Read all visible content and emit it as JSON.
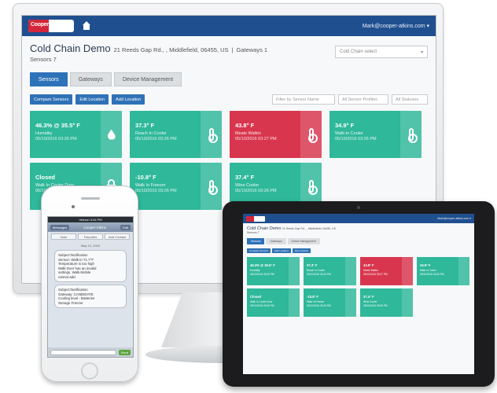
{
  "app": {
    "logo_text": "Cooper",
    "user": "Mark@cooper-atkins.com ▾",
    "title": "Cold Chain Demo",
    "address": "21 Reeds Gap Rd., , Middlefield, 06455, US",
    "gateways": "Gateways 1",
    "sensors": "Sensors 7",
    "select_placeholder": "Cold Chain select"
  },
  "tabs": [
    {
      "label": "Sensors",
      "active": true
    },
    {
      "label": "Gateways",
      "active": false
    },
    {
      "label": "Device Management",
      "active": false
    }
  ],
  "toolbar": {
    "buttons": [
      "Compare Sensors",
      "Edit Location",
      "Add Location"
    ],
    "filter_name": "Filter by Sensor Name",
    "filter_profile": "All Sensor Profiles",
    "filter_status": "All Statuses"
  },
  "cards": [
    {
      "reading": "46.3% @ 35.5° F",
      "name": "Humidity",
      "time": "05/10/2016 03:26 PM",
      "color": "#2fb89a",
      "icon": "humidity-drop-icon"
    },
    {
      "reading": "37.3° F",
      "name": "Reach In Cooler",
      "time": "05/10/2016 03:26 PM",
      "color": "#2fb89a",
      "icon": "thermometer-icon"
    },
    {
      "reading": "43.8° F",
      "name": "Meats Walkin",
      "time": "05/10/2016 03:27 PM",
      "color": "#d8364e",
      "icon": "thermometer-icon"
    },
    {
      "reading": "34.9° F",
      "name": "Walk-in Cooler",
      "time": "05/10/2016 03:26 PM",
      "color": "#2fb89a",
      "icon": "thermometer-icon"
    },
    {
      "reading": "Closed",
      "name": "Walk In Cooler Door",
      "time": "05/10/2016 03:26 PM",
      "color": "#2fb89a",
      "icon": "lock-icon"
    },
    {
      "reading": "-10.8° F",
      "name": "Walk In Freezer",
      "time": "05/10/2016 03:26 PM",
      "color": "#2fb89a",
      "icon": "thermometer-icon"
    },
    {
      "reading": "37.4° F",
      "name": "Wine Cooler",
      "time": "05/10/2016 03:26 PM",
      "color": "#2fb89a",
      "icon": "thermometer-icon"
    }
  ],
  "phone": {
    "status": "Verizon 3:44 PM",
    "back": "Messages",
    "title": "Cooper-Atkins",
    "edit": "Edit",
    "seg": [
      "Note",
      "Favorites",
      "Add Contact"
    ],
    "date": "May 10, 2016",
    "msg1": "Subject:Notification\nSensor: Walk-in 71.7°F\nTemperature is too high\nWalk Door has an invalid\nsettings. Walk Mobile\ncannot add",
    "msg2": "Subject:Notification\nGateway: CANDIDATE\nCooling level - Batteries\nStorage Freezer",
    "send": "Send"
  },
  "tablet": {
    "title": "Cold Chain Demo",
    "sub": "Sensors 7"
  }
}
